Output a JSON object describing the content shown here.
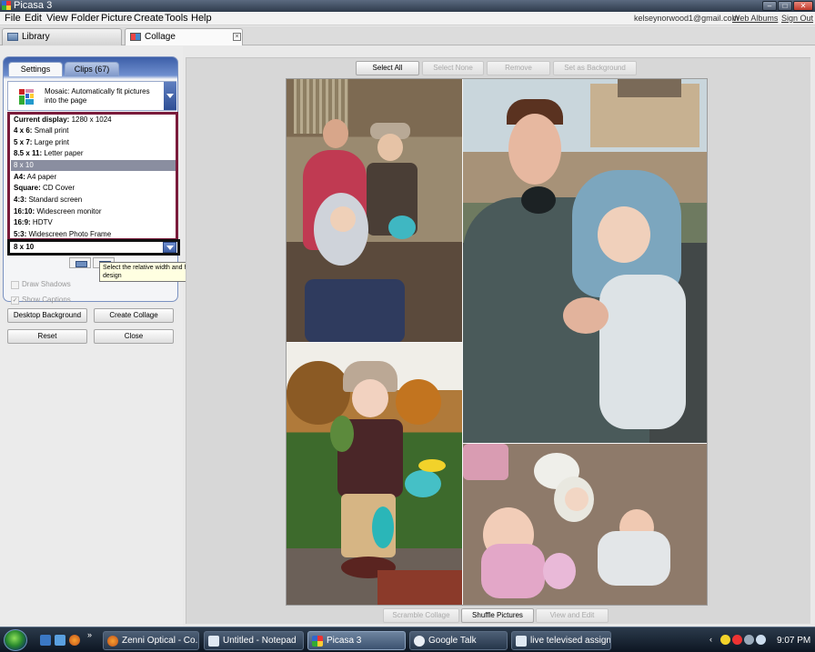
{
  "window": {
    "title": "Picasa 3"
  },
  "menu": {
    "items": [
      "File",
      "Edit",
      "View",
      "Folder",
      "Picture",
      "Create",
      "Tools",
      "Help"
    ],
    "account": "kelseynorwood1@gmail.com",
    "web_albums": "Web Albums",
    "sign_out": "Sign Out"
  },
  "tabs": {
    "library": "Library",
    "collage": "Collage"
  },
  "settings": {
    "tab_settings": "Settings",
    "tab_clips": "Clips (67)",
    "style_description": "Mosaic:  Automatically fit pictures into the page",
    "size_options": [
      {
        "name": "Current display:",
        "detail": "1280 x 1024"
      },
      {
        "name": "4 x 6:",
        "detail": "Small print"
      },
      {
        "name": "5 x 7:",
        "detail": "Large print"
      },
      {
        "name": "8.5 x 11:",
        "detail": "Letter paper"
      },
      {
        "name": "8 x 10",
        "detail": ""
      },
      {
        "name": "A4:",
        "detail": "A4 paper"
      },
      {
        "name": "Square:",
        "detail": "CD Cover"
      },
      {
        "name": "4:3:",
        "detail": "Standard screen"
      },
      {
        "name": "16:10:",
        "detail": "Widescreen monitor"
      },
      {
        "name": "16:9:",
        "detail": "HDTV"
      },
      {
        "name": "5:3:",
        "detail": "Widescreen Photo Frame"
      }
    ],
    "selected_size": "8 x 10",
    "tooltip": "Select the relative width and height of your design",
    "draw_shadows": "Draw Shadows",
    "show_captions": "Show Captions",
    "show_captions_checked": true
  },
  "buttons": {
    "desktop_background": "Desktop Background",
    "create_collage": "Create Collage",
    "reset": "Reset",
    "close": "Close"
  },
  "toolbar": {
    "select_all": "Select All",
    "select_none": "Select None",
    "remove": "Remove",
    "set_as_background": "Set as Background",
    "scramble_collage": "Scramble Collage",
    "shuffle_pictures": "Shuffle Pictures",
    "view_and_edit": "View and Edit"
  },
  "taskbar": {
    "tasks": [
      "Zenni Optical - Co...",
      "Untitled - Notepad",
      "Picasa 3",
      "Google Talk",
      "live televised assign..."
    ],
    "active_task": "Picasa 3",
    "clock": "9:07 PM"
  }
}
